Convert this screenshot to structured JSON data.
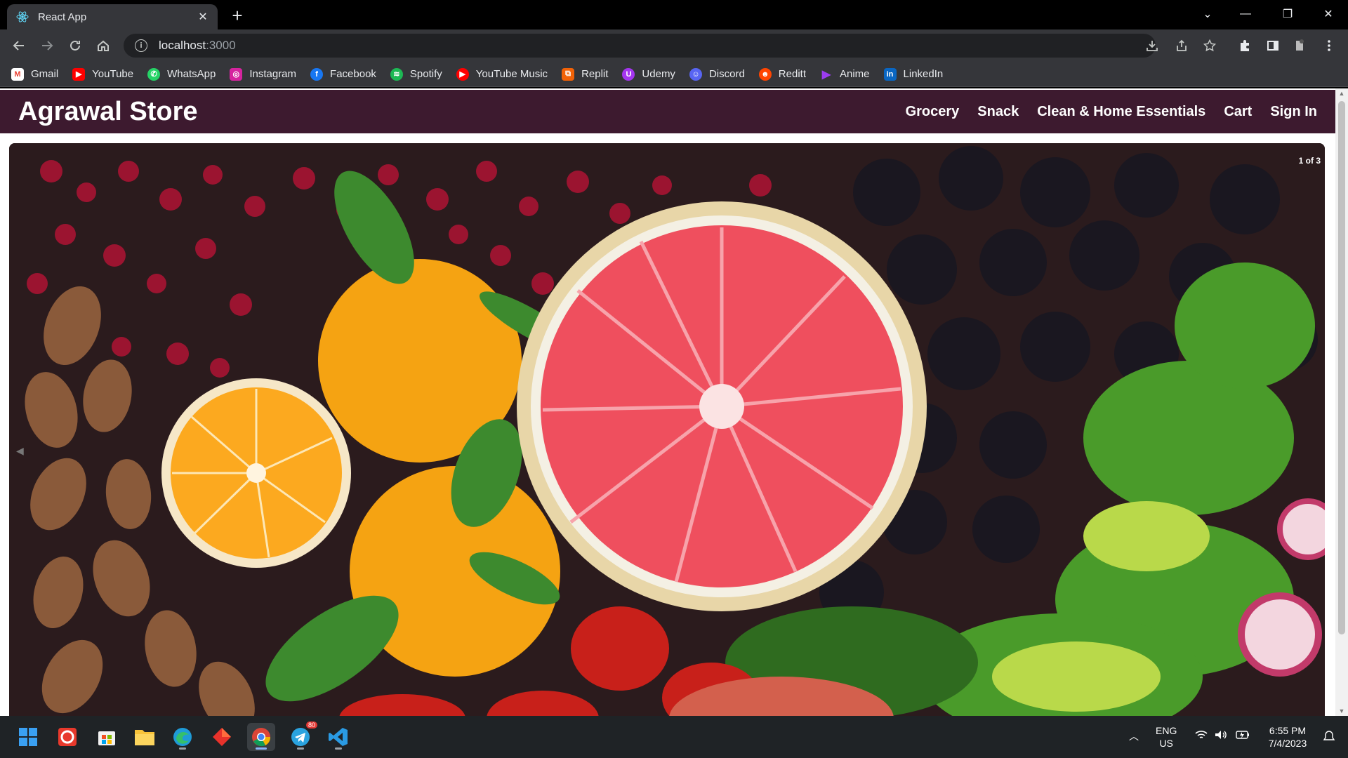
{
  "browser": {
    "tab_title": "React App",
    "url_host": "localhost",
    "url_port": ":3000",
    "bookmarks": [
      {
        "label": "Gmail",
        "icon": "gmail-icon",
        "color": "#ea4335"
      },
      {
        "label": "YouTube",
        "icon": "youtube-icon",
        "color": "#ff0000"
      },
      {
        "label": "WhatsApp",
        "icon": "whatsapp-icon",
        "color": "#25d366"
      },
      {
        "label": "Instagram",
        "icon": "instagram-icon",
        "color": "#d6249f"
      },
      {
        "label": "Facebook",
        "icon": "facebook-icon",
        "color": "#1877f2"
      },
      {
        "label": "Spotify",
        "icon": "spotify-icon",
        "color": "#1db954"
      },
      {
        "label": "YouTube Music",
        "icon": "youtube-music-icon",
        "color": "#ff0000"
      },
      {
        "label": "Replit",
        "icon": "replit-icon",
        "color": "#f26207"
      },
      {
        "label": "Udemy",
        "icon": "udemy-icon",
        "color": "#a435f0"
      },
      {
        "label": "Discord",
        "icon": "discord-icon",
        "color": "#5865f2"
      },
      {
        "label": "Reditt",
        "icon": "reddit-icon",
        "color": "#ff4500"
      },
      {
        "label": "Anime",
        "icon": "anime-icon",
        "color": "#9b3cf0"
      },
      {
        "label": "LinkedIn",
        "icon": "linkedin-icon",
        "color": "#0a66c2"
      }
    ]
  },
  "site": {
    "brand": "Agrawal Store",
    "nav": [
      "Grocery",
      "Snack",
      "Clean & Home Essentials",
      "Cart",
      "Sign In"
    ],
    "carousel": {
      "counter": "1 of 3",
      "current": 1,
      "total": 3
    },
    "colors": {
      "navbar": "#3d1a2f"
    }
  },
  "taskbar": {
    "icons": [
      "windows-start-icon",
      "antivirus-icon",
      "store-icon",
      "file-explorer-icon",
      "edge-icon",
      "app-icon",
      "chrome-icon",
      "telegram-icon",
      "vscode-icon"
    ],
    "telegram_badge": "80",
    "language": "ENG",
    "region": "US",
    "time": "6:55 PM",
    "date": "7/4/2023"
  }
}
